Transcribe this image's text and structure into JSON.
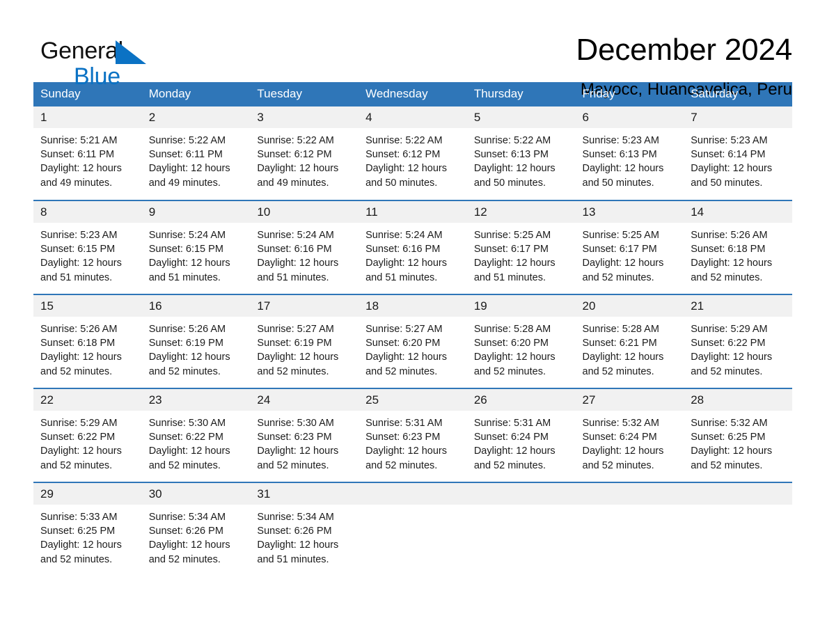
{
  "brand": {
    "name_part1": "General",
    "name_part2": "Blue",
    "triangle_icon": "blue-triangle-icon",
    "accent_color": "#0b72c4"
  },
  "header": {
    "title": "December 2024",
    "subtitle": "Mayocc, Huancavelica, Peru"
  },
  "calendar": {
    "header_bg": "#2f76b8",
    "header_text_color": "#ffffff",
    "daynum_bg": "#f1f1f1",
    "weekdays": [
      "Sunday",
      "Monday",
      "Tuesday",
      "Wednesday",
      "Thursday",
      "Friday",
      "Saturday"
    ],
    "weeks": [
      [
        {
          "day": "1",
          "sunrise": "Sunrise: 5:21 AM",
          "sunset": "Sunset: 6:11 PM",
          "daylight_line1": "Daylight: 12 hours",
          "daylight_line2": "and 49 minutes."
        },
        {
          "day": "2",
          "sunrise": "Sunrise: 5:22 AM",
          "sunset": "Sunset: 6:11 PM",
          "daylight_line1": "Daylight: 12 hours",
          "daylight_line2": "and 49 minutes."
        },
        {
          "day": "3",
          "sunrise": "Sunrise: 5:22 AM",
          "sunset": "Sunset: 6:12 PM",
          "daylight_line1": "Daylight: 12 hours",
          "daylight_line2": "and 49 minutes."
        },
        {
          "day": "4",
          "sunrise": "Sunrise: 5:22 AM",
          "sunset": "Sunset: 6:12 PM",
          "daylight_line1": "Daylight: 12 hours",
          "daylight_line2": "and 50 minutes."
        },
        {
          "day": "5",
          "sunrise": "Sunrise: 5:22 AM",
          "sunset": "Sunset: 6:13 PM",
          "daylight_line1": "Daylight: 12 hours",
          "daylight_line2": "and 50 minutes."
        },
        {
          "day": "6",
          "sunrise": "Sunrise: 5:23 AM",
          "sunset": "Sunset: 6:13 PM",
          "daylight_line1": "Daylight: 12 hours",
          "daylight_line2": "and 50 minutes."
        },
        {
          "day": "7",
          "sunrise": "Sunrise: 5:23 AM",
          "sunset": "Sunset: 6:14 PM",
          "daylight_line1": "Daylight: 12 hours",
          "daylight_line2": "and 50 minutes."
        }
      ],
      [
        {
          "day": "8",
          "sunrise": "Sunrise: 5:23 AM",
          "sunset": "Sunset: 6:15 PM",
          "daylight_line1": "Daylight: 12 hours",
          "daylight_line2": "and 51 minutes."
        },
        {
          "day": "9",
          "sunrise": "Sunrise: 5:24 AM",
          "sunset": "Sunset: 6:15 PM",
          "daylight_line1": "Daylight: 12 hours",
          "daylight_line2": "and 51 minutes."
        },
        {
          "day": "10",
          "sunrise": "Sunrise: 5:24 AM",
          "sunset": "Sunset: 6:16 PM",
          "daylight_line1": "Daylight: 12 hours",
          "daylight_line2": "and 51 minutes."
        },
        {
          "day": "11",
          "sunrise": "Sunrise: 5:24 AM",
          "sunset": "Sunset: 6:16 PM",
          "daylight_line1": "Daylight: 12 hours",
          "daylight_line2": "and 51 minutes."
        },
        {
          "day": "12",
          "sunrise": "Sunrise: 5:25 AM",
          "sunset": "Sunset: 6:17 PM",
          "daylight_line1": "Daylight: 12 hours",
          "daylight_line2": "and 51 minutes."
        },
        {
          "day": "13",
          "sunrise": "Sunrise: 5:25 AM",
          "sunset": "Sunset: 6:17 PM",
          "daylight_line1": "Daylight: 12 hours",
          "daylight_line2": "and 52 minutes."
        },
        {
          "day": "14",
          "sunrise": "Sunrise: 5:26 AM",
          "sunset": "Sunset: 6:18 PM",
          "daylight_line1": "Daylight: 12 hours",
          "daylight_line2": "and 52 minutes."
        }
      ],
      [
        {
          "day": "15",
          "sunrise": "Sunrise: 5:26 AM",
          "sunset": "Sunset: 6:18 PM",
          "daylight_line1": "Daylight: 12 hours",
          "daylight_line2": "and 52 minutes."
        },
        {
          "day": "16",
          "sunrise": "Sunrise: 5:26 AM",
          "sunset": "Sunset: 6:19 PM",
          "daylight_line1": "Daylight: 12 hours",
          "daylight_line2": "and 52 minutes."
        },
        {
          "day": "17",
          "sunrise": "Sunrise: 5:27 AM",
          "sunset": "Sunset: 6:19 PM",
          "daylight_line1": "Daylight: 12 hours",
          "daylight_line2": "and 52 minutes."
        },
        {
          "day": "18",
          "sunrise": "Sunrise: 5:27 AM",
          "sunset": "Sunset: 6:20 PM",
          "daylight_line1": "Daylight: 12 hours",
          "daylight_line2": "and 52 minutes."
        },
        {
          "day": "19",
          "sunrise": "Sunrise: 5:28 AM",
          "sunset": "Sunset: 6:20 PM",
          "daylight_line1": "Daylight: 12 hours",
          "daylight_line2": "and 52 minutes."
        },
        {
          "day": "20",
          "sunrise": "Sunrise: 5:28 AM",
          "sunset": "Sunset: 6:21 PM",
          "daylight_line1": "Daylight: 12 hours",
          "daylight_line2": "and 52 minutes."
        },
        {
          "day": "21",
          "sunrise": "Sunrise: 5:29 AM",
          "sunset": "Sunset: 6:22 PM",
          "daylight_line1": "Daylight: 12 hours",
          "daylight_line2": "and 52 minutes."
        }
      ],
      [
        {
          "day": "22",
          "sunrise": "Sunrise: 5:29 AM",
          "sunset": "Sunset: 6:22 PM",
          "daylight_line1": "Daylight: 12 hours",
          "daylight_line2": "and 52 minutes."
        },
        {
          "day": "23",
          "sunrise": "Sunrise: 5:30 AM",
          "sunset": "Sunset: 6:22 PM",
          "daylight_line1": "Daylight: 12 hours",
          "daylight_line2": "and 52 minutes."
        },
        {
          "day": "24",
          "sunrise": "Sunrise: 5:30 AM",
          "sunset": "Sunset: 6:23 PM",
          "daylight_line1": "Daylight: 12 hours",
          "daylight_line2": "and 52 minutes."
        },
        {
          "day": "25",
          "sunrise": "Sunrise: 5:31 AM",
          "sunset": "Sunset: 6:23 PM",
          "daylight_line1": "Daylight: 12 hours",
          "daylight_line2": "and 52 minutes."
        },
        {
          "day": "26",
          "sunrise": "Sunrise: 5:31 AM",
          "sunset": "Sunset: 6:24 PM",
          "daylight_line1": "Daylight: 12 hours",
          "daylight_line2": "and 52 minutes."
        },
        {
          "day": "27",
          "sunrise": "Sunrise: 5:32 AM",
          "sunset": "Sunset: 6:24 PM",
          "daylight_line1": "Daylight: 12 hours",
          "daylight_line2": "and 52 minutes."
        },
        {
          "day": "28",
          "sunrise": "Sunrise: 5:32 AM",
          "sunset": "Sunset: 6:25 PM",
          "daylight_line1": "Daylight: 12 hours",
          "daylight_line2": "and 52 minutes."
        }
      ],
      [
        {
          "day": "29",
          "sunrise": "Sunrise: 5:33 AM",
          "sunset": "Sunset: 6:25 PM",
          "daylight_line1": "Daylight: 12 hours",
          "daylight_line2": "and 52 minutes."
        },
        {
          "day": "30",
          "sunrise": "Sunrise: 5:34 AM",
          "sunset": "Sunset: 6:26 PM",
          "daylight_line1": "Daylight: 12 hours",
          "daylight_line2": "and 52 minutes."
        },
        {
          "day": "31",
          "sunrise": "Sunrise: 5:34 AM",
          "sunset": "Sunset: 6:26 PM",
          "daylight_line1": "Daylight: 12 hours",
          "daylight_line2": "and 51 minutes."
        },
        {
          "day": "",
          "sunrise": "",
          "sunset": "",
          "daylight_line1": "",
          "daylight_line2": ""
        },
        {
          "day": "",
          "sunrise": "",
          "sunset": "",
          "daylight_line1": "",
          "daylight_line2": ""
        },
        {
          "day": "",
          "sunrise": "",
          "sunset": "",
          "daylight_line1": "",
          "daylight_line2": ""
        },
        {
          "day": "",
          "sunrise": "",
          "sunset": "",
          "daylight_line1": "",
          "daylight_line2": ""
        }
      ]
    ]
  }
}
